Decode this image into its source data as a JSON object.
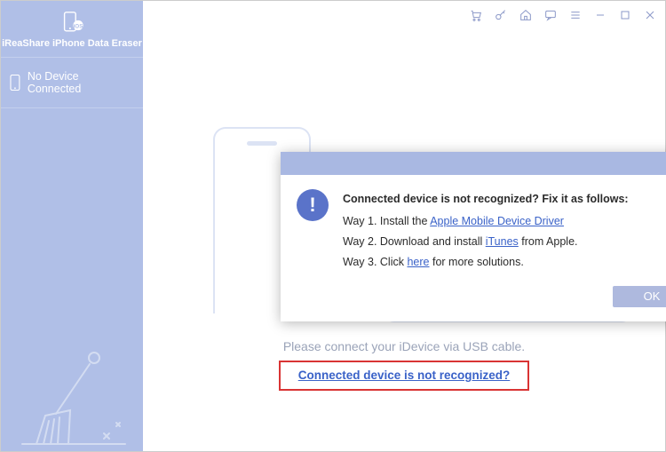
{
  "app": {
    "title": "iReaShare iPhone Data Eraser"
  },
  "sidebar": {
    "device_status": "No Device Connected"
  },
  "toolbar": {
    "cart": "cart",
    "key": "key",
    "home": "home",
    "feedback": "feedback",
    "menu": "menu",
    "minimize": "minimize",
    "maximize": "maximize",
    "close": "close"
  },
  "main": {
    "connect_msg": "Please connect your iDevice via USB cable.",
    "not_recognized_link": "Connected device is not recognized?"
  },
  "modal": {
    "title": "Connected device is not recognized? Fix it as follows:",
    "way1_prefix": "Way 1. Install the ",
    "way1_link": "Apple Mobile Device Driver",
    "way2_prefix": "Way 2. Download and install ",
    "way2_link": "iTunes",
    "way2_suffix": " from Apple.",
    "way3_prefix": "Way 3. Click ",
    "way3_link": "here",
    "way3_suffix": " for more solutions.",
    "ok": "OK"
  }
}
